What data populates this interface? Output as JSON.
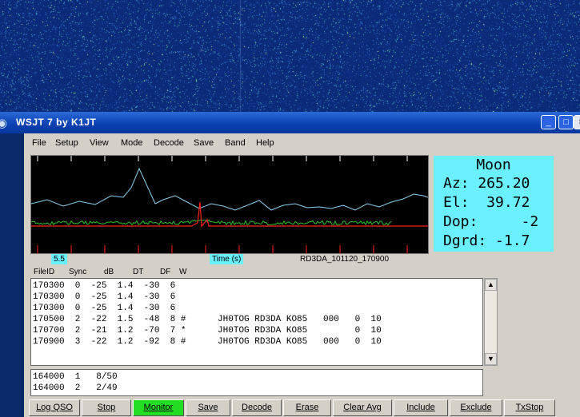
{
  "window": {
    "title": "WSJT 7    by K1JT",
    "controls": {
      "minimize": "_",
      "maximize": "□",
      "close": "×"
    }
  },
  "menu": [
    "File",
    "Setup",
    "View",
    "Mode",
    "Decode",
    "Save",
    "Band",
    "Help"
  ],
  "spectrum": {
    "colors": {
      "avg": "#8fd0f0",
      "sync": "#ff2020",
      "now": "#30c030",
      "ticks": "#ff2020"
    },
    "time_start": "5.5",
    "time_label": "Time (s)",
    "file_name": "RD3DA_101120_170900"
  },
  "moon": {
    "title": "Moon",
    "az": "Az: 265.20",
    "el": "El:  39.72",
    "dop": "Dop:     -2",
    "dgrd": "Dgrd: -1.7"
  },
  "columns": [
    "FileID",
    "Sync",
    "dB",
    "DT",
    "DF",
    "W"
  ],
  "decodes": [
    "170300  0  -25  1.4  -30  6",
    "170300  0  -25  1.4  -30  6",
    "170300  0  -25  1.4  -30  6",
    "170500  2  -22  1.5  -48  8 #      JH0TOG RD3DA KO85   000   0  10",
    "170700  2  -21  1.2  -70  7 *      JH0TOG RD3DA KO85         0  10",
    "170900  3  -22  1.2  -92  8 #      JH0TOG RD3DA KO85   000   0  10"
  ],
  "averages": [
    "164000  1   8/50",
    "164000  2   2/49"
  ],
  "buttons": [
    "Log QSO",
    "Stop",
    "Monitor",
    "Save",
    "Decode",
    "Erase",
    "Clear Avg",
    "Include",
    "Exclude",
    "TxStop"
  ],
  "active_button": "Monitor"
}
